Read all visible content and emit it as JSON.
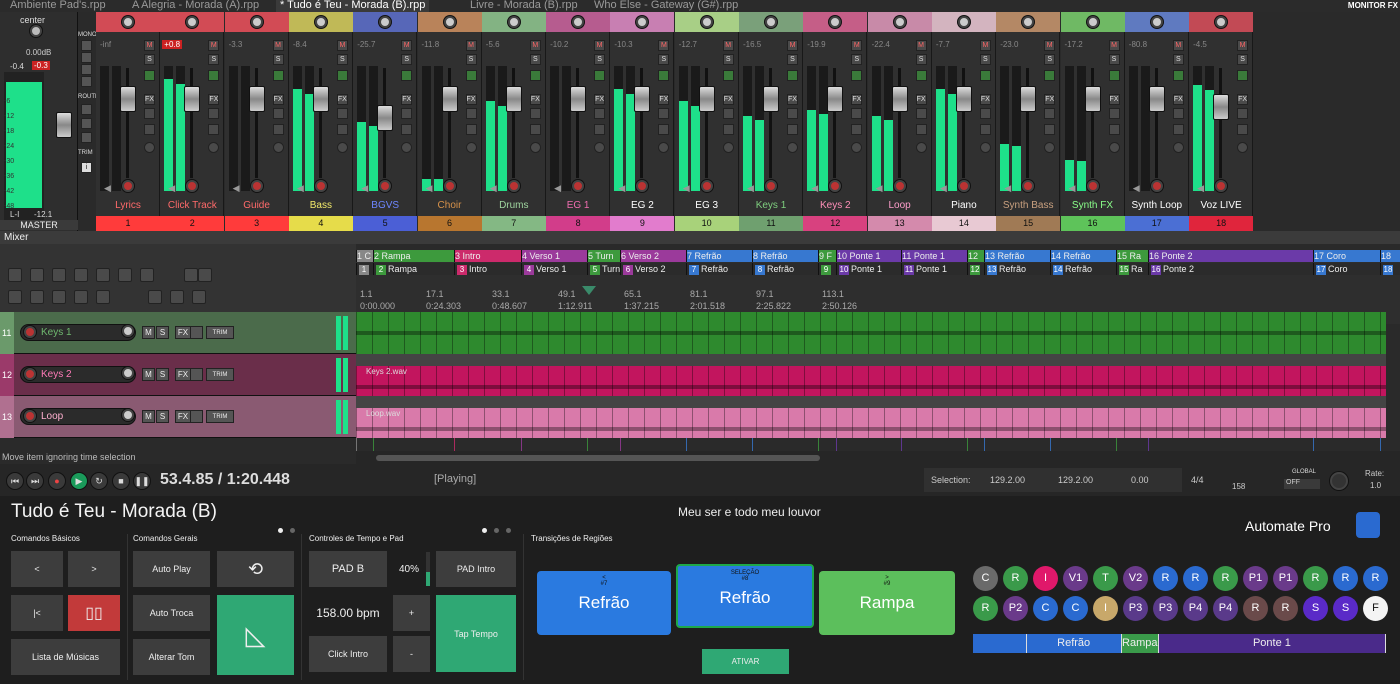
{
  "tabs": [
    "Ambiente Pad's.rpp",
    "A Alegria - Morada (A).rpp",
    "* Tudo é Teu - Morada (B).rpp",
    "Livre - Morada (B).rpp",
    "Who Else - Gateway (G#).rpp"
  ],
  "monitor_fx": "MONITOR FX",
  "master": {
    "label": "MASTER",
    "pan": "center",
    "db": "0.00dB",
    "peak_l": "-0.4",
    "peak_r": "-0.3",
    "lr_l": "L-I",
    "lr_r": "-12.1",
    "mono": "MONO",
    "route": "ROUTE",
    "trim": "TRIM",
    "scale": [
      "-6",
      "-12",
      "-18",
      "-24",
      "-30",
      "-36",
      "-42",
      "-48"
    ]
  },
  "strips": [
    {
      "name": "Lyrics",
      "num": "1",
      "db": "-inf",
      "peak": "",
      "color": "#d24b55",
      "ncolor": "#ff3b3b",
      "textcolor": "#ff6a6a",
      "meter": 0,
      "fader": 0.28
    },
    {
      "name": "Click Track",
      "num": "2",
      "db": "",
      "peak": "+0.8",
      "color": "#d24b55",
      "ncolor": "#ff3b3b",
      "textcolor": "#ff6a6a",
      "meter": 0.9,
      "fader": 0.28
    },
    {
      "name": "Guide",
      "num": "3",
      "db": "-3.3",
      "peak": "",
      "color": "#d24b55",
      "ncolor": "#ff3b3b",
      "textcolor": "#ff6a6a",
      "meter": 0,
      "fader": 0.28
    },
    {
      "name": "Bass",
      "num": "4",
      "db": "-8.4",
      "peak": "",
      "color": "#c0b957",
      "ncolor": "#e6dc4a",
      "textcolor": "#f2e96a",
      "meter": 0.82,
      "fader": 0.28
    },
    {
      "name": "BGVS",
      "num": "5",
      "db": "-25.7",
      "peak": "",
      "color": "#5767b8",
      "ncolor": "#4b5fd6",
      "textcolor": "#6d86ff",
      "meter": 0.55,
      "fader": 0.45
    },
    {
      "name": "Choir",
      "num": "6",
      "db": "-11.8",
      "peak": "",
      "color": "#b9835a",
      "ncolor": "#b8762f",
      "textcolor": "#d8924a",
      "meter": 0.1,
      "fader": 0.28
    },
    {
      "name": "Drums",
      "num": "7",
      "db": "-5.6",
      "peak": "",
      "color": "#83b383",
      "ncolor": "#84b884",
      "textcolor": "#9fd59f",
      "meter": 0.72,
      "fader": 0.28
    },
    {
      "name": "EG 1",
      "num": "8",
      "db": "-10.2",
      "peak": "",
      "color": "#b65c8f",
      "ncolor": "#d23d8a",
      "textcolor": "#f06db0",
      "meter": 0,
      "fader": 0.28
    },
    {
      "name": "EG 2",
      "num": "9",
      "db": "-10.3",
      "peak": "",
      "color": "#c87fb2",
      "ncolor": "#e27ccd",
      "textcolor": "#ffffff",
      "meter": 0.82,
      "fader": 0.28
    },
    {
      "name": "EG 3",
      "num": "10",
      "db": "-12.7",
      "peak": "",
      "color": "#a8cf86",
      "ncolor": "#a8d27a",
      "textcolor": "#ffffff",
      "meter": 0.72,
      "fader": 0.28
    },
    {
      "name": "Keys 1",
      "num": "11",
      "db": "-16.5",
      "peak": "",
      "color": "#7aa07a",
      "ncolor": "#6fa06f",
      "textcolor": "#7fcf7f",
      "meter": 0.6,
      "fader": 0.28
    },
    {
      "name": "Keys 2",
      "num": "12",
      "db": "-19.9",
      "peak": "",
      "color": "#c55e87",
      "ncolor": "#d8417f",
      "textcolor": "#ff8fb8",
      "meter": 0.65,
      "fader": 0.28
    },
    {
      "name": "Loop",
      "num": "13",
      "db": "-22.4",
      "peak": "",
      "color": "#c88aa8",
      "ncolor": "#d48aac",
      "textcolor": "#ff9ecb",
      "meter": 0.6,
      "fader": 0.28
    },
    {
      "name": "Piano",
      "num": "14",
      "db": "-7.7",
      "peak": "",
      "color": "#d3b4bf",
      "ncolor": "#e8c9d3",
      "textcolor": "#ffffff",
      "meter": 0.82,
      "fader": 0.28
    },
    {
      "name": "Synth Bass",
      "num": "15",
      "db": "-23.0",
      "peak": "",
      "color": "#b48865",
      "ncolor": "#a07a55",
      "textcolor": "#c9a07f",
      "meter": 0.38,
      "fader": 0.28
    },
    {
      "name": "Synth FX",
      "num": "16",
      "db": "-17.2",
      "peak": "",
      "color": "#6fb964",
      "ncolor": "#5ec35a",
      "textcolor": "#8aff8a",
      "meter": 0.25,
      "fader": 0.28
    },
    {
      "name": "Synth Loop",
      "num": "17",
      "db": "-80.8",
      "peak": "",
      "color": "#5f7ac0",
      "ncolor": "#4b6fd4",
      "textcolor": "#ffffff",
      "meter": 0,
      "fader": 0.28
    },
    {
      "name": "Voz LIVE",
      "num": "18",
      "db": "-4.5",
      "peak": "",
      "color": "#c24a55",
      "ncolor": "#e0253c",
      "textcolor": "#ffffff",
      "meter": 0.85,
      "fader": 0.35
    }
  ],
  "mixer_label": "Mixer",
  "regions": [
    {
      "label": "1 C",
      "color": "#888"
    },
    {
      "label": "2 Rampa",
      "color": "#3d9a3d"
    },
    {
      "label": "3 Intro",
      "color": "#cc2a6b"
    },
    {
      "label": "4 Verso 1",
      "color": "#9b3a9b"
    },
    {
      "label": "5 Turn",
      "color": "#3d9a3d"
    },
    {
      "label": "6 Verso 2",
      "color": "#9b3a9b"
    },
    {
      "label": "7 Refrão",
      "color": "#3778d0"
    },
    {
      "label": "8 Refrão",
      "color": "#3778d0"
    },
    {
      "label": "9 F",
      "color": "#3d9a3d"
    },
    {
      "label": "10 Ponte 1",
      "color": "#6b3aa8"
    },
    {
      "label": "11 Ponte 1",
      "color": "#6b3aa8"
    },
    {
      "label": "12",
      "color": "#3d9a3d"
    },
    {
      "label": "13 Refrão",
      "color": "#3778d0"
    },
    {
      "label": "14 Refrão",
      "color": "#3778d0"
    },
    {
      "label": "15 Ra",
      "color": "#3d9a3d"
    },
    {
      "label": "16 Ponte 2",
      "color": "#6b3aa8"
    },
    {
      "label": "17 Coro",
      "color": "#3778d0"
    },
    {
      "label": "18",
      "color": "#3778d0"
    }
  ],
  "markers": [
    {
      "n": "1",
      "label": ""
    },
    {
      "n": "2",
      "label": "Rampa"
    },
    {
      "n": "3",
      "label": "Intro"
    },
    {
      "n": "4",
      "label": "Verso 1"
    },
    {
      "n": "5",
      "label": "Turn"
    },
    {
      "n": "6",
      "label": "Verso 2"
    },
    {
      "n": "7",
      "label": "Refrão"
    },
    {
      "n": "8",
      "label": "Refrão"
    },
    {
      "n": "9",
      "label": ""
    },
    {
      "n": "10",
      "label": "Ponte 1"
    },
    {
      "n": "11",
      "label": "Ponte 1"
    },
    {
      "n": "12",
      "label": ""
    },
    {
      "n": "13",
      "label": "Refrão"
    },
    {
      "n": "14",
      "label": "Refrão"
    },
    {
      "n": "15",
      "label": "Ra"
    },
    {
      "n": "16",
      "label": "Ponte 2"
    },
    {
      "n": "17",
      "label": "Coro"
    },
    {
      "n": "18",
      "label": ""
    }
  ],
  "ruler": [
    {
      "bar": "1.1",
      "time": "0:00.000"
    },
    {
      "bar": "17.1",
      "time": "0:24.303"
    },
    {
      "bar": "33.1",
      "time": "0:48.607"
    },
    {
      "bar": "49.1",
      "time": "1:12.911"
    },
    {
      "bar": "65.1",
      "time": "1:37.215"
    },
    {
      "bar": "81.1",
      "time": "2:01.518"
    },
    {
      "bar": "97.1",
      "time": "2:25.822"
    },
    {
      "bar": "113.1",
      "time": "2:50.126"
    }
  ],
  "tracks": [
    {
      "num": "11",
      "name": "Keys 1",
      "color": "#6b9a6b",
      "lane": "#2e8a2e",
      "item": ""
    },
    {
      "num": "12",
      "name": "Keys 2",
      "color": "#9b3a6a",
      "lane": "#c2155e",
      "item": "Keys 2.wav"
    },
    {
      "num": "13",
      "name": "Loop",
      "color": "#b07090",
      "lane": "#d97aaa",
      "item": "Loop.wav"
    }
  ],
  "status": "Move item ignoring time selection",
  "transport": {
    "position": "53.4.85 / 1:20.448",
    "state": "[Playing]",
    "selection_label": "Selection:",
    "sel_start": "129.2.00",
    "sel_end": "129.2.00",
    "sel_len": "0.00",
    "timesig": "4/4",
    "bpm": "158",
    "global": "GLOBAL",
    "off": "OFF",
    "rate_label": "Rate:",
    "rate": "1.0"
  },
  "panel": {
    "song": "Tudo é Teu - Morada (B)",
    "lyric": "Meu ser e todo meu louvor",
    "brand": "Automate Pro",
    "basic_title": "Comandos Básicos",
    "general_title": "Comandos Gerais",
    "tempo_title": "Controles de Tempo e Pad",
    "trans_title": "Transições de Regiões",
    "prev": "<",
    "next": ">",
    "start": "|<",
    "list": "Lista de Músicas",
    "autoplay": "Auto Play",
    "autotroca": "Auto Troca",
    "altertom": "Alterar Tom",
    "pad": "PAD B",
    "pad_pct": "40%",
    "pad_intro": "PAD Intro",
    "bpm": "158.00 bpm",
    "plus": "+",
    "minus": "-",
    "click_intro": "Click Intro",
    "tap": "Tap Tempo",
    "card_prev": {
      "top": "<",
      "num": "#7",
      "label": "Refrão"
    },
    "card_sel": {
      "top": "SELEÇÃO",
      "num": "#8",
      "label": "Refrão"
    },
    "card_next": {
      "top": ">",
      "num": "#9",
      "label": "Rampa"
    },
    "ativar": "ATIVAR",
    "circles": [
      {
        "t": "C",
        "c": "#6a6a6a"
      },
      {
        "t": "R",
        "c": "#3a9a4a"
      },
      {
        "t": "I",
        "c": "#e0186a"
      },
      {
        "t": "V1",
        "c": "#6a3a8a"
      },
      {
        "t": "T",
        "c": "#3a9a4a"
      },
      {
        "t": "V2",
        "c": "#6a3a8a"
      },
      {
        "t": "R",
        "c": "#2a6ad0"
      },
      {
        "t": "R",
        "c": "#2a6ad0"
      },
      {
        "t": "R",
        "c": "#3a9a4a"
      },
      {
        "t": "P1",
        "c": "#6a3a8a"
      },
      {
        "t": "P1",
        "c": "#6a3a8a"
      },
      {
        "t": "R",
        "c": "#3a9a4a"
      },
      {
        "t": "R",
        "c": "#2a6ad0"
      },
      {
        "t": "R",
        "c": "#2a6ad0"
      },
      {
        "t": "R",
        "c": "#3a9a4a"
      },
      {
        "t": "P2",
        "c": "#6a3a8a"
      },
      {
        "t": "C",
        "c": "#2a6ad0"
      },
      {
        "t": "C",
        "c": "#2a6ad0"
      },
      {
        "t": "I",
        "c": "#c8a86a"
      },
      {
        "t": "P3",
        "c": "#5a3a8a"
      },
      {
        "t": "P3",
        "c": "#5a3a8a"
      },
      {
        "t": "P4",
        "c": "#5a3a8a"
      },
      {
        "t": "P4",
        "c": "#5a3a8a"
      },
      {
        "t": "R",
        "c": "#6a4a4a"
      },
      {
        "t": "R",
        "c": "#6a4a4a"
      },
      {
        "t": "S",
        "c": "#5a2ac8"
      },
      {
        "t": "S",
        "c": "#5a2ac8"
      },
      {
        "t": "F",
        "c": "#f4f4f4"
      }
    ],
    "progress": [
      {
        "label": "",
        "c": "#2a6ad0",
        "w": 0.13
      },
      {
        "label": "Refrão",
        "c": "#2a6ad0",
        "w": 0.23
      },
      {
        "label": "Rampa",
        "c": "#3a9a4a",
        "w": 0.09
      },
      {
        "label": "Ponte 1",
        "c": "#4a2a8a",
        "w": 0.55
      }
    ]
  }
}
